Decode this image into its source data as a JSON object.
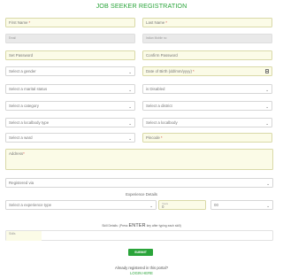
{
  "title": "JOB SEEKER REGISTRATION",
  "fields": {
    "first_name": "First Name",
    "last_name": "Last Name",
    "email_label": "Email",
    "mobile_label": "Indian Mobile no",
    "set_password": "Set Password",
    "confirm_password": "Confirm Password",
    "gender": "Select a gender",
    "dob": "Date of Birth (dd/mm/yyyy)",
    "marital": "Select a marital status",
    "is_disabled": "is Disabled",
    "category": "Select a category",
    "district": "Select a district",
    "localbody_type": "Select a localbody type",
    "localbody": "Select a localbody",
    "ward": "Select a ward",
    "pincode": "Pincode",
    "address": "Address",
    "registered_via": "Registered via",
    "experience_heading": "Experience Details",
    "experience_type": "Select a experience type",
    "years_label": "Years",
    "years_value": "0",
    "months_value": "00",
    "skill_prefix": "Skill Details: (Press",
    "skill_key": "ENTER",
    "skill_suffix": "key after typing each skill)",
    "skill_field_label": "Skills"
  },
  "required_mark": "*",
  "submit_label": "SUBMIT",
  "already_text": "Already registered in this portal?",
  "login_text": "LOGIN HERE",
  "colors": {
    "accent": "#2aa43a",
    "field_bg": "#fbfbe7"
  }
}
